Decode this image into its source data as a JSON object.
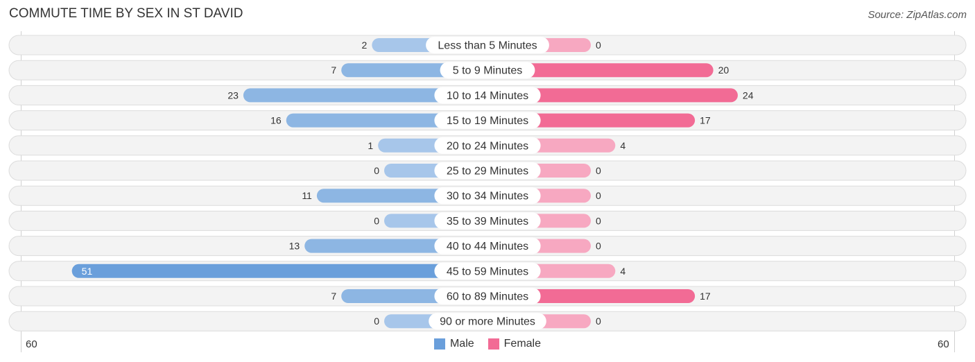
{
  "title": "COMMUTE TIME BY SEX IN ST DAVID",
  "source": "Source: ZipAtlas.com",
  "colors": {
    "male": "#6a9fdb",
    "male_light": "#a7c6ea",
    "female": "#f26b95",
    "female_light": "#f7a8c1",
    "row_bg": "#f3f3f3",
    "label_bg": "#ffffff"
  },
  "legend": {
    "male_label": "Male",
    "female_label": "Female"
  },
  "axis": {
    "left_label": "60",
    "right_label": "60"
  },
  "chart_data": {
    "type": "bar",
    "orientation": "horizontal-diverging",
    "title": "COMMUTE TIME BY SEX IN ST DAVID",
    "xlim": [
      -60,
      60
    ],
    "x_tick_labels": [
      "60",
      "60"
    ],
    "legend": [
      "Male",
      "Female"
    ],
    "legend_position": "bottom-center",
    "categories": [
      "Less than 5 Minutes",
      "5 to 9 Minutes",
      "10 to 14 Minutes",
      "15 to 19 Minutes",
      "20 to 24 Minutes",
      "25 to 29 Minutes",
      "30 to 34 Minutes",
      "35 to 39 Minutes",
      "40 to 44 Minutes",
      "45 to 59 Minutes",
      "60 to 89 Minutes",
      "90 or more Minutes"
    ],
    "series": [
      {
        "name": "Male",
        "values": [
          2,
          7,
          23,
          16,
          1,
          0,
          11,
          0,
          13,
          51,
          7,
          0
        ]
      },
      {
        "name": "Female",
        "values": [
          0,
          20,
          24,
          17,
          4,
          0,
          0,
          0,
          0,
          4,
          17,
          0
        ]
      }
    ]
  }
}
